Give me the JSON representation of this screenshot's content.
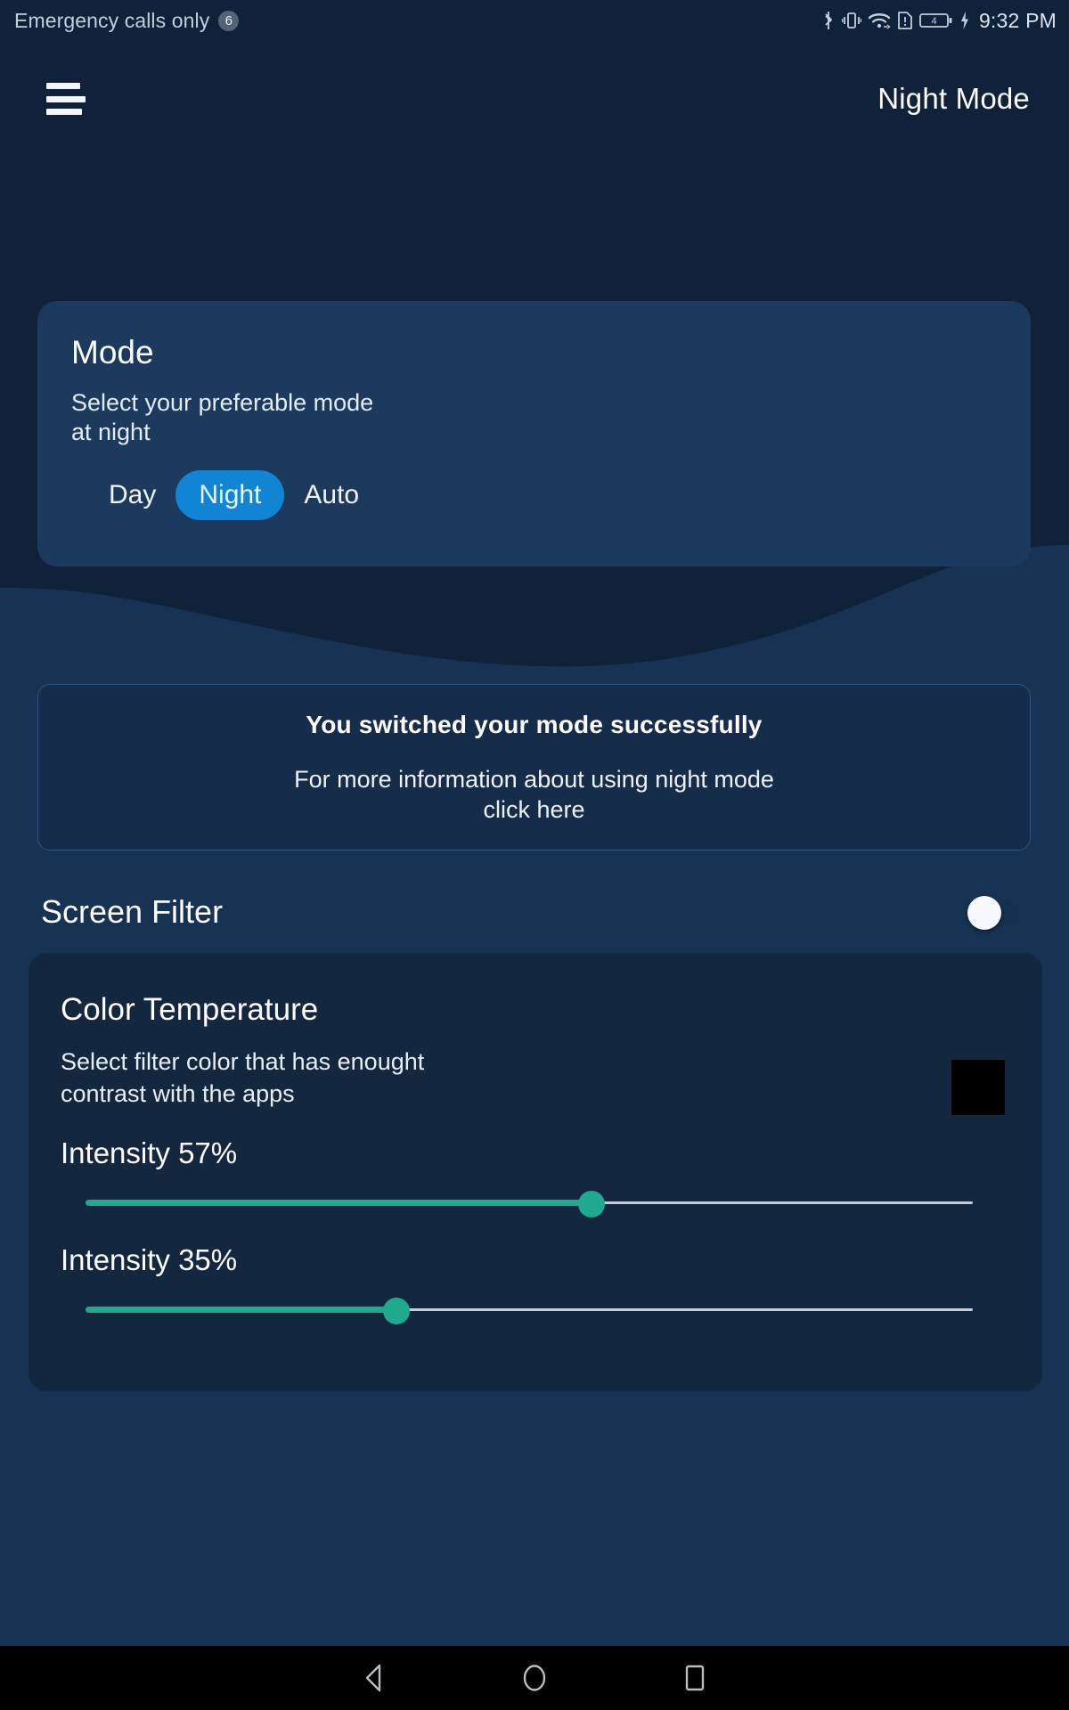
{
  "status_bar": {
    "carrier_text": "Emergency calls only",
    "notification_count": "6",
    "time": "9:32 PM",
    "icons": [
      "bluetooth-icon",
      "vibrate-icon",
      "wifi-icon",
      "sim-alert-icon",
      "battery-icon",
      "charging-bolt-icon"
    ],
    "battery_level_label": "4"
  },
  "app_bar": {
    "menu_icon": "hamburger-menu-icon",
    "title": "Night Mode"
  },
  "mode_card": {
    "title": "Mode",
    "subtitle": "Select your preferable mode\n at night",
    "options": [
      {
        "label": "Day",
        "selected": false
      },
      {
        "label": "Night",
        "selected": true
      },
      {
        "label": "Auto",
        "selected": false
      }
    ],
    "selected_value": "Night",
    "selected_color": "#1184d4"
  },
  "info_card": {
    "title": "You switched your mode successfully",
    "body": "For more information about using night mode\nclick here"
  },
  "screen_filter": {
    "label": "Screen Filter",
    "toggle_state": "off"
  },
  "color_temperature": {
    "title": "Color Temperature",
    "subtitle": "Select filter color that has enought\ncontrast with the apps",
    "swatch_color": "#000000",
    "sliders": [
      {
        "label": "Intensity 57%",
        "value": 57,
        "accent": "#1fa98e"
      },
      {
        "label": "Intensity 35%",
        "value": 35,
        "accent": "#1fa98e"
      }
    ]
  },
  "nav_bar": {
    "buttons": [
      {
        "name": "back-icon"
      },
      {
        "name": "home-icon"
      },
      {
        "name": "recents-icon"
      }
    ]
  },
  "theme": {
    "header_bg": "#10223a",
    "page_bg": "#183253",
    "card_bg": "#1b3a5e",
    "temp_card_bg": "#13273f",
    "accent_blue": "#1184d4",
    "accent_teal": "#1fa98e"
  }
}
